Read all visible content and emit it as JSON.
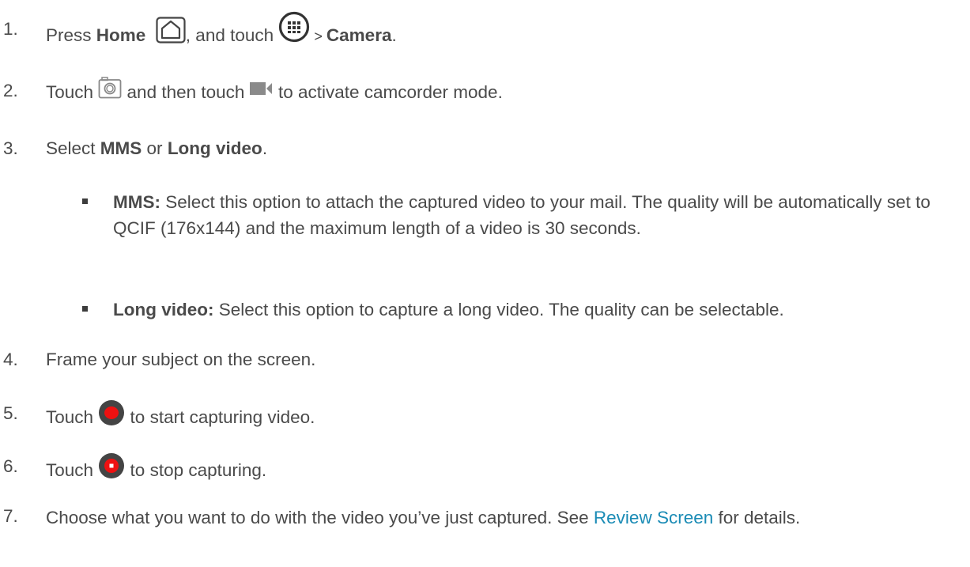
{
  "steps": [
    {
      "num": "1.",
      "pre": "Press ",
      "home_label": "Home",
      "mid": ", and touch ",
      "gt": " > ",
      "camera_label": "Camera",
      "end": "."
    },
    {
      "num": "2.",
      "pre": "Touch ",
      "mid": " and then touch ",
      "end": " to activate camcorder mode."
    },
    {
      "num": "3.",
      "pre": "Select ",
      "mms": "MMS",
      "or": " or ",
      "long": "Long video",
      "end": "."
    },
    {
      "num": "4.",
      "text": "Frame your subject on the screen."
    },
    {
      "num": "5.",
      "pre": "Touch ",
      "end": " to start capturing video."
    },
    {
      "num": "6.",
      "pre": "Touch ",
      "end": " to stop capturing."
    },
    {
      "num": "7.",
      "text": "Choose what you want to do with the video you’ve just captured. See ",
      "link": "Review Screen",
      "end": " for details."
    }
  ],
  "options": [
    {
      "label": "MMS:",
      "text": " Select this option to attach the captured video to your mail. The quality will be automatically set to QCIF (176x144) and the maximum length of a video is 30 seconds."
    },
    {
      "label": "Long video:",
      "text": " Select this option to capture a long video. The quality can be selectable."
    }
  ],
  "icons": [
    "home-icon",
    "apps-icon",
    "camera-mode-icon",
    "camcorder-icon",
    "record-icon",
    "stop-icon"
  ]
}
